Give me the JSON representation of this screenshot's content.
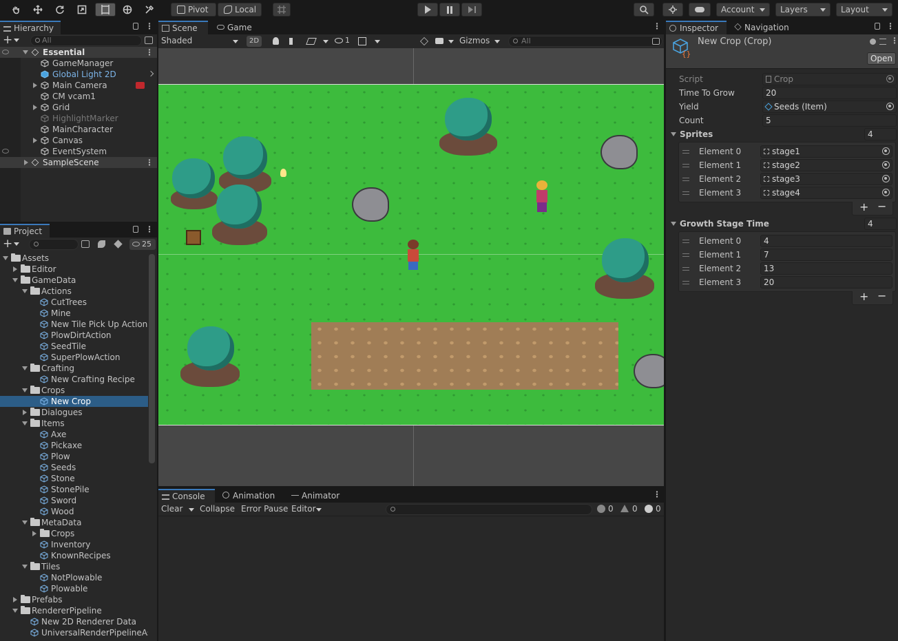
{
  "toolbar": {
    "pivot_label": "Pivot",
    "local_label": "Local",
    "account_label": "Account",
    "layers_label": "Layers",
    "layout_label": "Layout"
  },
  "hierarchy": {
    "tab_label": "Hierarchy",
    "search_placeholder": "All",
    "scene_name": "Essential",
    "items": [
      {
        "label": "GameManager"
      },
      {
        "label": "Global Light 2D"
      },
      {
        "label": "Main Camera"
      },
      {
        "label": "CM vcam1"
      },
      {
        "label": "Grid"
      },
      {
        "label": "HighlightMarker"
      },
      {
        "label": "MainCharacter"
      },
      {
        "label": "Canvas"
      },
      {
        "label": "EventSystem"
      }
    ],
    "second_scene": "SampleScene"
  },
  "project": {
    "tab_label": "Project",
    "hidden_count": "25",
    "tree": [
      {
        "label": "Assets"
      },
      {
        "label": "Editor"
      },
      {
        "label": "GameData"
      },
      {
        "label": "Actions"
      },
      {
        "label": "CutTrees"
      },
      {
        "label": "Mine"
      },
      {
        "label": "New Tile Pick Up Action"
      },
      {
        "label": "PlowDirtAction"
      },
      {
        "label": "SeedTile"
      },
      {
        "label": "SuperPlowAction"
      },
      {
        "label": "Crafting"
      },
      {
        "label": "New Crafting Recipe"
      },
      {
        "label": "Crops"
      },
      {
        "label": "New Crop"
      },
      {
        "label": "Dialogues"
      },
      {
        "label": "Items"
      },
      {
        "label": "Axe"
      },
      {
        "label": "Pickaxe"
      },
      {
        "label": "Plow"
      },
      {
        "label": "Seeds"
      },
      {
        "label": "Stone"
      },
      {
        "label": "StonePile"
      },
      {
        "label": "Sword"
      },
      {
        "label": "Wood"
      },
      {
        "label": "MetaData"
      },
      {
        "label": "Crops"
      },
      {
        "label": "Inventory"
      },
      {
        "label": "KnownRecipes"
      },
      {
        "label": "Tiles"
      },
      {
        "label": "NotPlowable"
      },
      {
        "label": "Plowable"
      },
      {
        "label": "Prefabs"
      },
      {
        "label": "RendererPipeline"
      },
      {
        "label": "New 2D Renderer Data"
      },
      {
        "label": "UniversalRenderPipelineAs:"
      }
    ]
  },
  "scene": {
    "tab_scene": "Scene",
    "tab_game": "Game",
    "shading": "Shaded",
    "mode_2d": "2D",
    "hidden_count": "1",
    "gizmos": "Gizmos",
    "search_placeholder": "All"
  },
  "console": {
    "tab_console": "Console",
    "tab_animation": "Animation",
    "tab_animator": "Animator",
    "clear": "Clear",
    "collapse": "Collapse",
    "error_pause": "Error Pause",
    "editor": "Editor",
    "count_info": "0",
    "count_warn": "0",
    "count_err": "0"
  },
  "inspector": {
    "tab_inspector": "Inspector",
    "tab_navigation": "Navigation",
    "title": "New Crop (Crop)",
    "open_button": "Open",
    "script_label": "Script",
    "script_value": "Crop",
    "time_label": "Time To Grow",
    "time_value": "20",
    "yield_label": "Yield",
    "yield_value": "Seeds (Item)",
    "count_label": "Count",
    "count_value": "5",
    "sprites_label": "Sprites",
    "sprites_size": "4",
    "sprites": [
      {
        "label": "Element 0",
        "value": "stage1"
      },
      {
        "label": "Element 1",
        "value": "stage2"
      },
      {
        "label": "Element 2",
        "value": "stage3"
      },
      {
        "label": "Element 3",
        "value": "stage4"
      }
    ],
    "growth_label": "Growth Stage Time",
    "growth_size": "4",
    "growth": [
      {
        "label": "Element 0",
        "value": "4"
      },
      {
        "label": "Element 1",
        "value": "7"
      },
      {
        "label": "Element 2",
        "value": "13"
      },
      {
        "label": "Element 3",
        "value": "20"
      }
    ]
  },
  "colors": {
    "accent": "#3a79bb",
    "selection": "#2c5d87",
    "grass": "#3dbb3d",
    "dirt": "#a07d56"
  }
}
